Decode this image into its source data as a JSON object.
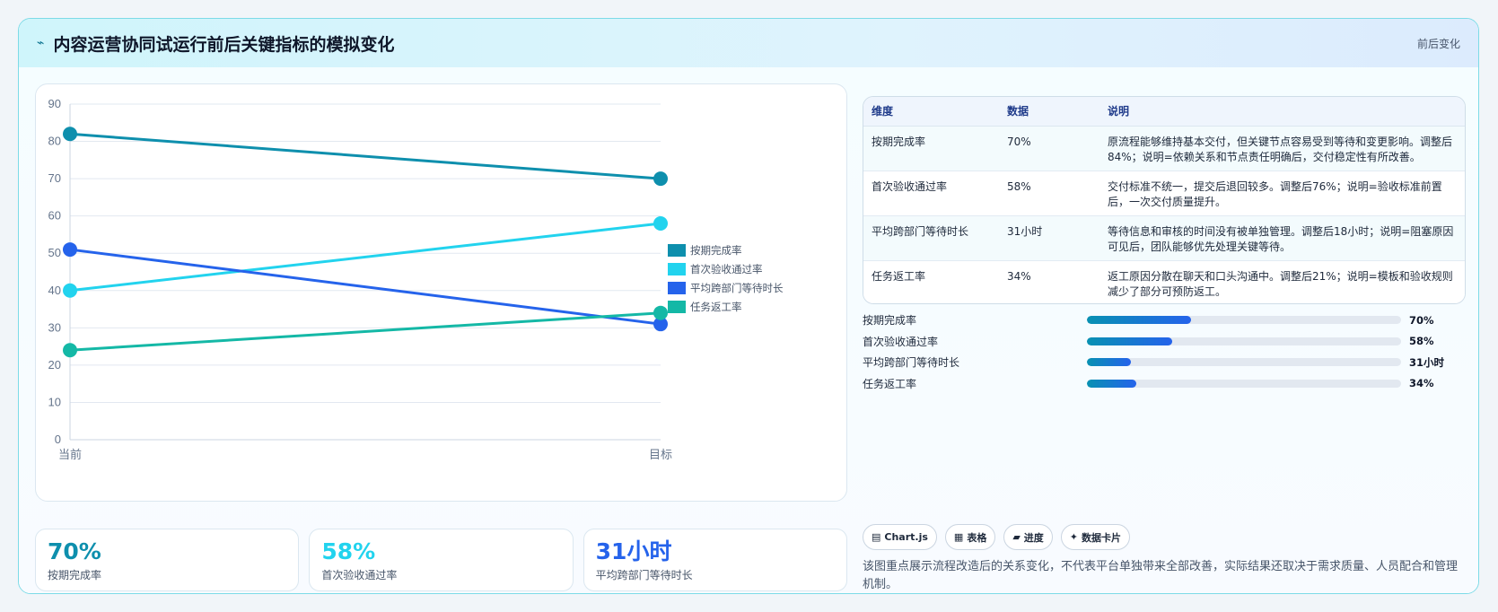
{
  "header": {
    "icon": "lightning-icon",
    "icon_glyph": "⌁",
    "title": "内容运营协同试运行前后关键指标的模拟变化",
    "tag": "前后变化"
  },
  "chart_data": {
    "type": "line",
    "categories": [
      "当前",
      "目标"
    ],
    "ylim": [
      0,
      90
    ],
    "yticks": [
      0,
      10,
      20,
      30,
      40,
      50,
      60,
      70,
      80,
      90
    ],
    "grid": true,
    "legend_position": "right",
    "series": [
      {
        "name": "按期完成率",
        "values": [
          82,
          70
        ],
        "color": "#0e8fad"
      },
      {
        "name": "首次验收通过率",
        "values": [
          40,
          58
        ],
        "color": "#22d3ee"
      },
      {
        "name": "平均跨部门等待时长",
        "values": [
          51,
          31
        ],
        "color": "#2563eb"
      },
      {
        "name": "任务返工率",
        "values": [
          24,
          34
        ],
        "color": "#14b8a6"
      }
    ]
  },
  "stats": [
    {
      "value": "70%",
      "label": "按期完成率",
      "color": "#0e8fad"
    },
    {
      "value": "58%",
      "label": "首次验收通过率",
      "color": "#22d3ee"
    },
    {
      "value": "31小时",
      "label": "平均跨部门等待时长",
      "color": "#2563eb"
    }
  ],
  "table": {
    "headers": [
      "维度",
      "数据",
      "说明"
    ],
    "rows": [
      [
        "按期完成率",
        "70%",
        "原流程能够维持基本交付，但关键节点容易受到等待和变更影响。调整后84%；说明=依赖关系和节点责任明确后，交付稳定性有所改善。"
      ],
      [
        "首次验收通过率",
        "58%",
        "交付标准不统一，提交后退回较多。调整后76%；说明=验收标准前置后，一次交付质量提升。"
      ],
      [
        "平均跨部门等待时长",
        "31小时",
        "等待信息和审核的时间没有被单独管理。调整后18小时；说明=阻塞原因可见后，团队能够优先处理关键等待。"
      ],
      [
        "任务返工率",
        "34%",
        "返工原因分散在聊天和口头沟通中。调整后21%；说明=模板和验收规则减少了部分可预防返工。"
      ]
    ]
  },
  "progress": [
    {
      "label": "按期完成率",
      "value": "70%",
      "fill": 0.33
    },
    {
      "label": "首次验收通过率",
      "value": "58%",
      "fill": 0.27
    },
    {
      "label": "平均跨部门等待时长",
      "value": "31小时",
      "fill": 0.14
    },
    {
      "label": "任务返工率",
      "value": "34%",
      "fill": 0.157
    }
  ],
  "chips": [
    {
      "icon": "chart-icon",
      "glyph": "▤",
      "label": "Chart.js"
    },
    {
      "icon": "table-icon",
      "glyph": "▦",
      "label": "表格"
    },
    {
      "icon": "progress-icon",
      "glyph": "▰",
      "label": "进度"
    },
    {
      "icon": "sparkle-icon",
      "glyph": "✦",
      "label": "数据卡片"
    }
  ],
  "note": "该图重点展示流程改造后的关系变化，不代表平台单独带来全部改善，实际结果还取决于需求质量、人员配合和管理机制。"
}
